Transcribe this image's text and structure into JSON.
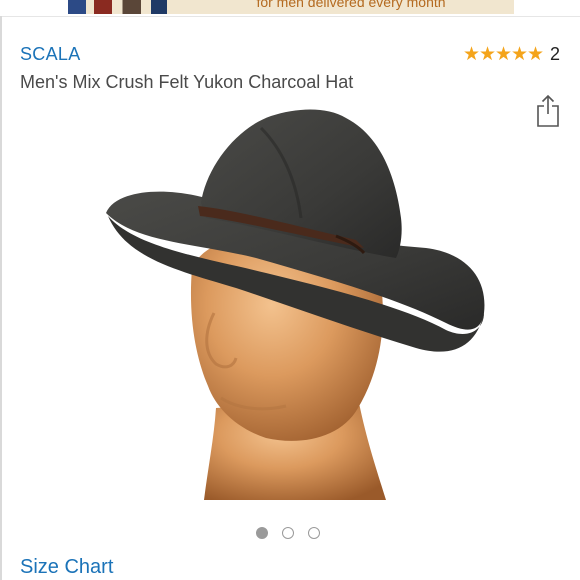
{
  "banner": {
    "text": "for men delivered every month"
  },
  "product": {
    "brand": "SCALA",
    "title": "Men's Mix Crush Felt Yukon Charcoal Hat",
    "rating": {
      "stars": 5,
      "count": "2",
      "star_color": "#f4a41b"
    },
    "image_alt_icon": "hat-on-mannequin"
  },
  "carousel": {
    "total": 3,
    "active_index": 0
  },
  "links": {
    "size_chart": "Size Chart"
  },
  "colors": {
    "link": "#1b73b8",
    "text": "#4a4a4a"
  },
  "icons": {
    "share": "share-icon",
    "star": "star-icon"
  }
}
